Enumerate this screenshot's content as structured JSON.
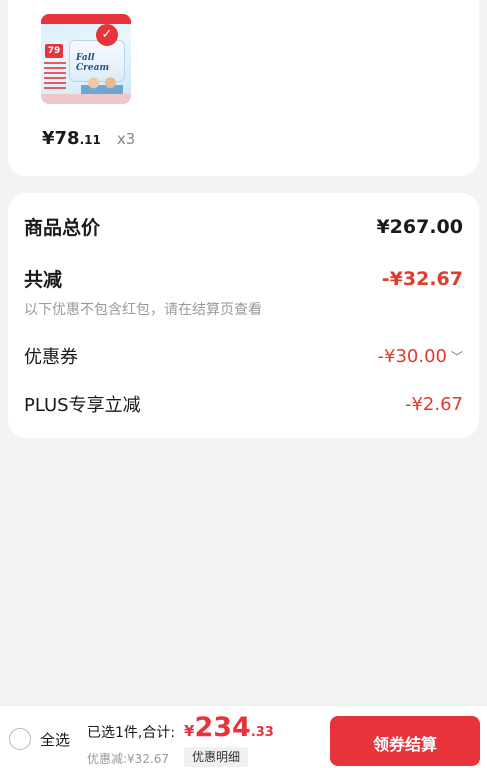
{
  "product": {
    "image_icon": "product-thumbnail",
    "thumb_badge": "79",
    "thumb_brand": "Fall Cream",
    "price_symbol": "¥",
    "price_main": "78",
    "price_decimal": ".11",
    "quantity": "x3"
  },
  "summary": {
    "total_label": "商品总价",
    "total_value": "¥267.00",
    "reduce_label": "共减",
    "reduce_value": "-¥32.67",
    "note": "以下优惠不包含红包，请在结算页查看",
    "coupon_label": "优惠券",
    "coupon_value": "-¥30.00",
    "plus_label": "PLUS专享立减",
    "plus_value": "-¥2.67"
  },
  "bottom_bar": {
    "select_all_label": "全选",
    "selected_text": "已选1件,合计:",
    "total_symbol": "¥",
    "total_main": "234",
    "total_decimal": ".33",
    "discount_text": "优惠减:¥32.67",
    "detail_button": "优惠明细",
    "checkout_button": "领券结算"
  },
  "colors": {
    "accent_red": "#e8333b",
    "discount_red": "#e03b2b",
    "background": "#f3f3f3"
  }
}
